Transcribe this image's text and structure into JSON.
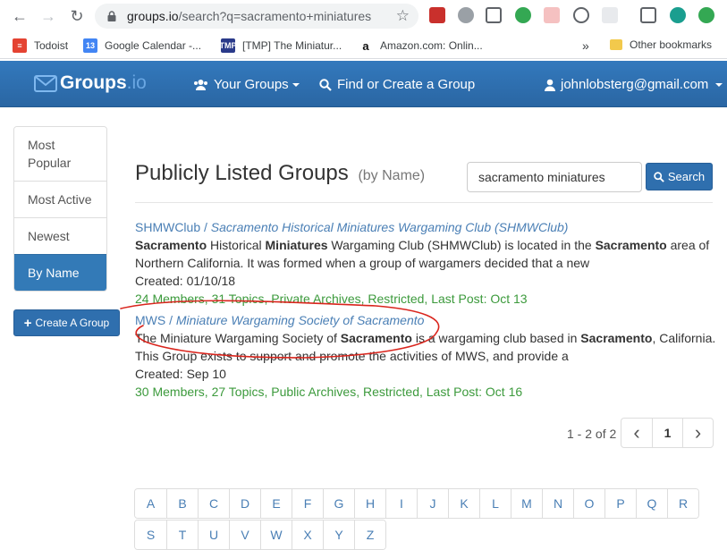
{
  "browser": {
    "url_host": "groups.io",
    "url_path": "/search?q=sacramento+miniatures",
    "bookmarks": [
      {
        "label": "Todoist"
      },
      {
        "label": "Google Calendar -..."
      },
      {
        "label": "[TMP] The Miniatur..."
      },
      {
        "label": "Amazon.com: Onlin..."
      }
    ],
    "overflow_label": "»",
    "other_bookmarks": "Other bookmarks"
  },
  "navbar": {
    "brand_a": "Groups",
    "brand_b": ".io",
    "your_groups": "Your Groups",
    "find_create": "Find or Create a Group",
    "user_email": "johnlobsterg@gmail.com"
  },
  "sidebar": {
    "items": [
      {
        "label": "Most Popular",
        "active": false
      },
      {
        "label": "Most Active",
        "active": false
      },
      {
        "label": "Newest",
        "active": false
      },
      {
        "label": "By Name",
        "active": true
      }
    ],
    "create_button": "Create A Group"
  },
  "main": {
    "title": "Publicly Listed Groups",
    "subtitle": "(by Name)",
    "search_value": "sacramento miniatures",
    "search_button": "Search",
    "results": [
      {
        "short": "SHMWClub",
        "sep": " / ",
        "full": "Sacramento Historical Miniatures Wargaming Club (SHMWClub)",
        "desc_html": "<b>Sacramento</b> Historical <b>Miniatures</b> Wargaming Club (SHMWClub) is located in the <b>Sacramento</b> area of Northern California. It was formed when a group of wargamers decided that a new",
        "created": "Created: 01/10/18",
        "meta": "24 Members, 31 Topics, Private Archives, Restricted, Last Post: Oct 13"
      },
      {
        "short": "MWS",
        "sep": " / ",
        "full": "Miniature Wargaming Society of Sacramento",
        "desc_html": "The Miniature Wargaming Society of <b>Sacramento</b> is a wargaming club based in <b>Sacramento</b>, California. This Group exists to support and promote the activities of MWS, and provide a",
        "created": "Created: Sep 10",
        "meta": "30 Members, 27 Topics, Public Archives, Restricted, Last Post: Oct 16"
      }
    ],
    "pager_info": "1 - 2 of 2",
    "pager_prev": "‹",
    "pager_current": "1",
    "pager_next": "›",
    "alpha_row1": [
      "A",
      "B",
      "C",
      "D",
      "E",
      "F",
      "G",
      "H",
      "I",
      "J",
      "K",
      "L",
      "M",
      "N",
      "O",
      "P",
      "Q",
      "R"
    ],
    "alpha_row2": [
      "S",
      "T",
      "U",
      "V",
      "W",
      "X",
      "Y",
      "Z"
    ]
  },
  "colors": {
    "navbar": "#3379bd",
    "primary_button": "#2f6fae",
    "link": "#4a7fb5",
    "meta_green": "#3c9a3c",
    "annotation_red": "#d9251d"
  }
}
